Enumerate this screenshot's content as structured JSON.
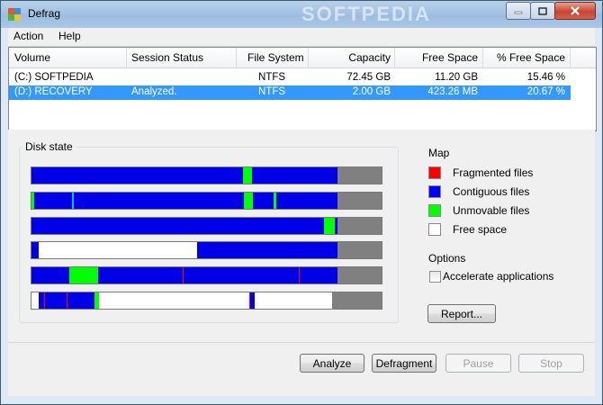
{
  "window": {
    "title": "Defrag",
    "watermark": "SOFTPEDIA"
  },
  "menu": {
    "items": [
      "Action",
      "Help"
    ]
  },
  "list": {
    "columns": [
      "Volume",
      "Session Status",
      "File System",
      "Capacity",
      "Free Space",
      "% Free Space"
    ],
    "rows": [
      {
        "volume": "(C:) SOFTPEDIA",
        "status": "",
        "fs": "NTFS",
        "capacity": "72.45 GB",
        "free": "11.20 GB",
        "pct": "15.46 %",
        "selected": false
      },
      {
        "volume": "(D:) RECOVERY",
        "status": "Analyzed.",
        "fs": "NTFS",
        "capacity": "2.00 GB",
        "free": "423.26 MB",
        "pct": "20.67 %",
        "selected": true
      }
    ]
  },
  "disk_state": {
    "title": "Disk state"
  },
  "map": {
    "title": "Map",
    "legend": [
      {
        "label": "Fragmented files",
        "color": "#ff0000"
      },
      {
        "label": "Contiguous files",
        "color": "#0000ff"
      },
      {
        "label": "Unmovable files",
        "color": "#00ff00"
      },
      {
        "label": "Free space",
        "color": "#ffffff"
      }
    ]
  },
  "options": {
    "title": "Options",
    "accelerate_label": "Accelerate applications",
    "accelerate_checked": false
  },
  "buttons": {
    "report": "Report...",
    "analyze": "Analyze",
    "defragment": "Defragment",
    "pause": "Pause",
    "stop": "Stop"
  },
  "colors": {
    "contiguous": "#0000e6",
    "unmovable": "#00ff00",
    "free": "#ffffff",
    "fragmented": "#ff0000",
    "unused": "#808080",
    "selection": "#3399ff"
  }
}
